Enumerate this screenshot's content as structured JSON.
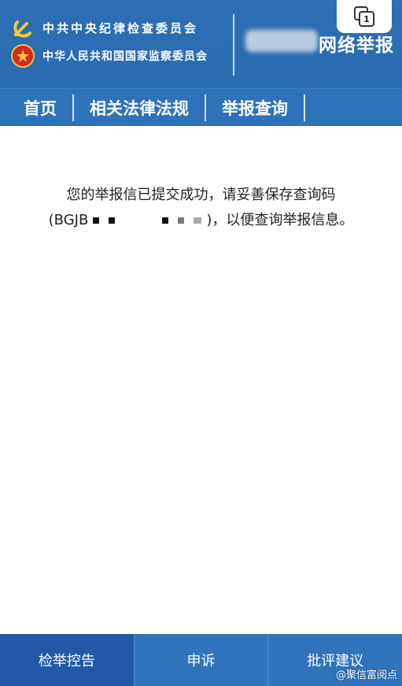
{
  "header": {
    "org_line1": "中共中央纪律检查委员会",
    "org_line2": "中华人民共和国国家监察委员会",
    "site_title": "网络举报",
    "tab_count": "1"
  },
  "nav": {
    "items": [
      {
        "label": "首页"
      },
      {
        "label": "相关法律法规"
      },
      {
        "label": "举报查询"
      }
    ]
  },
  "message": {
    "line1": "您的举报信已提交成功，请妥善保存查询码",
    "code_prefix": "(BGJB",
    "code_suffix": ")，以便查询举报信息。"
  },
  "bottom_nav": {
    "items": [
      {
        "label": "检举控告"
      },
      {
        "label": "申诉"
      },
      {
        "label": "批评建议"
      }
    ]
  },
  "watermark": "@聚信富阅点",
  "colors": {
    "header_bg": "#2c6fb5",
    "nav_bg": "#2e72b9",
    "bottom_active": "#2159a8",
    "bottom_bg": "#2f74bd"
  }
}
